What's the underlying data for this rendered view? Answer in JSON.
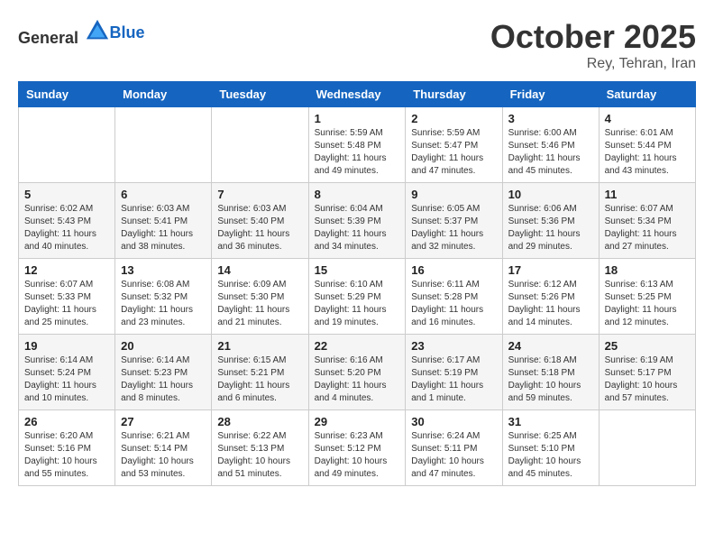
{
  "header": {
    "logo_general": "General",
    "logo_blue": "Blue",
    "month": "October 2025",
    "location": "Rey, Tehran, Iran"
  },
  "weekdays": [
    "Sunday",
    "Monday",
    "Tuesday",
    "Wednesday",
    "Thursday",
    "Friday",
    "Saturday"
  ],
  "weeks": [
    [
      {
        "day": "",
        "info": ""
      },
      {
        "day": "",
        "info": ""
      },
      {
        "day": "",
        "info": ""
      },
      {
        "day": "1",
        "info": "Sunrise: 5:59 AM\nSunset: 5:48 PM\nDaylight: 11 hours and 49 minutes."
      },
      {
        "day": "2",
        "info": "Sunrise: 5:59 AM\nSunset: 5:47 PM\nDaylight: 11 hours and 47 minutes."
      },
      {
        "day": "3",
        "info": "Sunrise: 6:00 AM\nSunset: 5:46 PM\nDaylight: 11 hours and 45 minutes."
      },
      {
        "day": "4",
        "info": "Sunrise: 6:01 AM\nSunset: 5:44 PM\nDaylight: 11 hours and 43 minutes."
      }
    ],
    [
      {
        "day": "5",
        "info": "Sunrise: 6:02 AM\nSunset: 5:43 PM\nDaylight: 11 hours and 40 minutes."
      },
      {
        "day": "6",
        "info": "Sunrise: 6:03 AM\nSunset: 5:41 PM\nDaylight: 11 hours and 38 minutes."
      },
      {
        "day": "7",
        "info": "Sunrise: 6:03 AM\nSunset: 5:40 PM\nDaylight: 11 hours and 36 minutes."
      },
      {
        "day": "8",
        "info": "Sunrise: 6:04 AM\nSunset: 5:39 PM\nDaylight: 11 hours and 34 minutes."
      },
      {
        "day": "9",
        "info": "Sunrise: 6:05 AM\nSunset: 5:37 PM\nDaylight: 11 hours and 32 minutes."
      },
      {
        "day": "10",
        "info": "Sunrise: 6:06 AM\nSunset: 5:36 PM\nDaylight: 11 hours and 29 minutes."
      },
      {
        "day": "11",
        "info": "Sunrise: 6:07 AM\nSunset: 5:34 PM\nDaylight: 11 hours and 27 minutes."
      }
    ],
    [
      {
        "day": "12",
        "info": "Sunrise: 6:07 AM\nSunset: 5:33 PM\nDaylight: 11 hours and 25 minutes."
      },
      {
        "day": "13",
        "info": "Sunrise: 6:08 AM\nSunset: 5:32 PM\nDaylight: 11 hours and 23 minutes."
      },
      {
        "day": "14",
        "info": "Sunrise: 6:09 AM\nSunset: 5:30 PM\nDaylight: 11 hours and 21 minutes."
      },
      {
        "day": "15",
        "info": "Sunrise: 6:10 AM\nSunset: 5:29 PM\nDaylight: 11 hours and 19 minutes."
      },
      {
        "day": "16",
        "info": "Sunrise: 6:11 AM\nSunset: 5:28 PM\nDaylight: 11 hours and 16 minutes."
      },
      {
        "day": "17",
        "info": "Sunrise: 6:12 AM\nSunset: 5:26 PM\nDaylight: 11 hours and 14 minutes."
      },
      {
        "day": "18",
        "info": "Sunrise: 6:13 AM\nSunset: 5:25 PM\nDaylight: 11 hours and 12 minutes."
      }
    ],
    [
      {
        "day": "19",
        "info": "Sunrise: 6:14 AM\nSunset: 5:24 PM\nDaylight: 11 hours and 10 minutes."
      },
      {
        "day": "20",
        "info": "Sunrise: 6:14 AM\nSunset: 5:23 PM\nDaylight: 11 hours and 8 minutes."
      },
      {
        "day": "21",
        "info": "Sunrise: 6:15 AM\nSunset: 5:21 PM\nDaylight: 11 hours and 6 minutes."
      },
      {
        "day": "22",
        "info": "Sunrise: 6:16 AM\nSunset: 5:20 PM\nDaylight: 11 hours and 4 minutes."
      },
      {
        "day": "23",
        "info": "Sunrise: 6:17 AM\nSunset: 5:19 PM\nDaylight: 11 hours and 1 minute."
      },
      {
        "day": "24",
        "info": "Sunrise: 6:18 AM\nSunset: 5:18 PM\nDaylight: 10 hours and 59 minutes."
      },
      {
        "day": "25",
        "info": "Sunrise: 6:19 AM\nSunset: 5:17 PM\nDaylight: 10 hours and 57 minutes."
      }
    ],
    [
      {
        "day": "26",
        "info": "Sunrise: 6:20 AM\nSunset: 5:16 PM\nDaylight: 10 hours and 55 minutes."
      },
      {
        "day": "27",
        "info": "Sunrise: 6:21 AM\nSunset: 5:14 PM\nDaylight: 10 hours and 53 minutes."
      },
      {
        "day": "28",
        "info": "Sunrise: 6:22 AM\nSunset: 5:13 PM\nDaylight: 10 hours and 51 minutes."
      },
      {
        "day": "29",
        "info": "Sunrise: 6:23 AM\nSunset: 5:12 PM\nDaylight: 10 hours and 49 minutes."
      },
      {
        "day": "30",
        "info": "Sunrise: 6:24 AM\nSunset: 5:11 PM\nDaylight: 10 hours and 47 minutes."
      },
      {
        "day": "31",
        "info": "Sunrise: 6:25 AM\nSunset: 5:10 PM\nDaylight: 10 hours and 45 minutes."
      },
      {
        "day": "",
        "info": ""
      }
    ]
  ]
}
